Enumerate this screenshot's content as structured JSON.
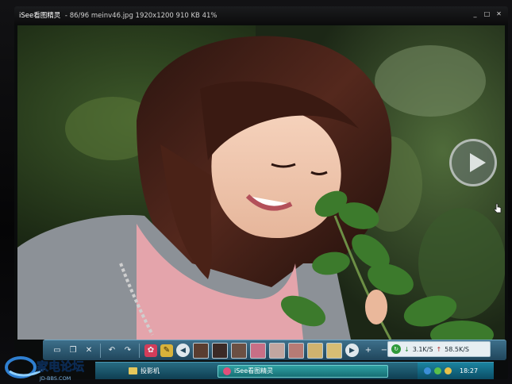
{
  "window": {
    "app_name": "iSee看图精灵",
    "file_info": "- 86/96  meinv46.jpg  1920x1200  910 KB  41%",
    "controls": [
      "▫",
      "▫",
      "✕"
    ]
  },
  "photo": {
    "description_colors": {
      "foliage": "#2b3f22",
      "hair": "#3a1c14",
      "sweater": "#8a8f95",
      "top": "#e7a7ae",
      "skin": "#f0c6ae"
    }
  },
  "overlay": {
    "next_icon": "play-next-icon"
  },
  "toolbar": {
    "buttons": [
      "folder-icon",
      "copy-icon",
      "delete-icon",
      "undo-icon",
      "redo-icon",
      "gift-icon",
      "brush-icon"
    ],
    "prev_icon": "◀",
    "next_icon": "▶",
    "zoom_in": "+",
    "zoom_out": "−",
    "thumbnail_colors": [
      "#5a3d30",
      "#3b2a26",
      "#6b5043",
      "#c86f86",
      "#c2a6a0",
      "#b77b75",
      "#cfb36f",
      "#d7bd74"
    ]
  },
  "network": {
    "download": "3.1K/S",
    "upload": "58.5K/S"
  },
  "taskbar": {
    "folder_label": "投影机",
    "active_label": "iSee看图精灵",
    "clock": "18:27"
  },
  "watermark": {
    "brand": "家电论坛",
    "url": "JD-BBS.COM"
  }
}
